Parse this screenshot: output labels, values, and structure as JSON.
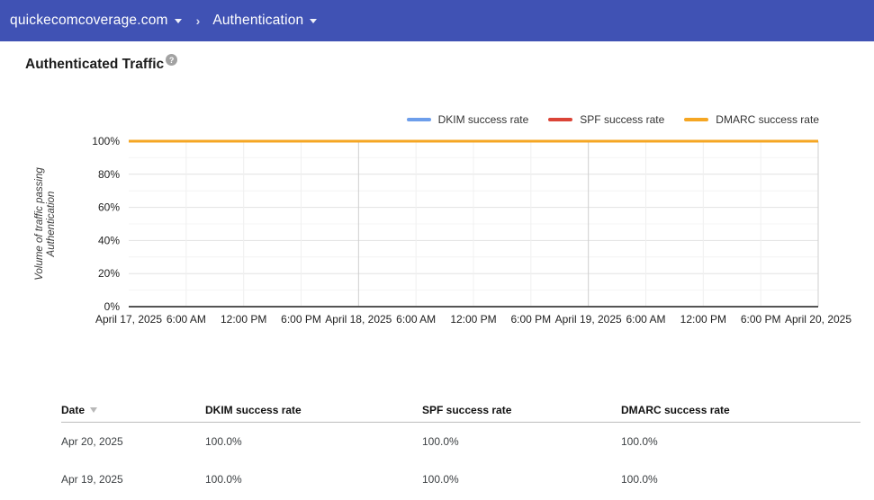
{
  "header": {
    "breadcrumb": {
      "domain": "quickecomcoverage.com",
      "separator": "›",
      "page": "Authentication"
    }
  },
  "page": {
    "title": "Authenticated Traffic",
    "help_icon": "?"
  },
  "chart_data": {
    "type": "line",
    "title": "Authenticated Traffic",
    "ylabel": "Volume of traffic passing Authentication",
    "ylabel_lines": [
      "Volume of traffic passing",
      "Authentication"
    ],
    "xlabel": "",
    "ylim": [
      0,
      100
    ],
    "grid": true,
    "legend_position": "top-right",
    "y_ticks": [
      "0%",
      "20%",
      "40%",
      "60%",
      "80%",
      "100%"
    ],
    "x_ticks": [
      "April 17, 2025",
      "6:00 AM",
      "12:00 PM",
      "6:00 PM",
      "April 18, 2025",
      "6:00 AM",
      "12:00 PM",
      "6:00 PM",
      "April 19, 2025",
      "6:00 AM",
      "12:00 PM",
      "6:00 PM",
      "April 20, 2025"
    ],
    "major_x_tick_every": 4,
    "series": [
      {
        "name": "DKIM success rate",
        "color": "#6D9EEB",
        "values": [
          100,
          100,
          100,
          100,
          100,
          100,
          100,
          100,
          100,
          100,
          100,
          100,
          100
        ]
      },
      {
        "name": "SPF success rate",
        "color": "#DB4437",
        "values": [
          100,
          100,
          100,
          100,
          100,
          100,
          100,
          100,
          100,
          100,
          100,
          100,
          100
        ]
      },
      {
        "name": "DMARC success rate",
        "color": "#F5A623",
        "values": [
          100,
          100,
          100,
          100,
          100,
          100,
          100,
          100,
          100,
          100,
          100,
          100,
          100
        ]
      }
    ]
  },
  "table": {
    "columns": [
      "Date",
      "DKIM success rate",
      "SPF success rate",
      "DMARC success rate"
    ],
    "sort": {
      "column": "Date",
      "direction": "desc"
    },
    "rows": [
      {
        "date": "Apr 20, 2025",
        "dkim": "100.0%",
        "spf": "100.0%",
        "dmarc": "100.0%"
      },
      {
        "date": "Apr 19, 2025",
        "dkim": "100.0%",
        "spf": "100.0%",
        "dmarc": "100.0%"
      }
    ]
  },
  "colors": {
    "topbar_bg": "#4052B4",
    "axis_line": "#545454",
    "grid_major": "#e2e2e2",
    "grid_minor": "#f4f4f4",
    "grid_day": "#cfcfcf"
  }
}
